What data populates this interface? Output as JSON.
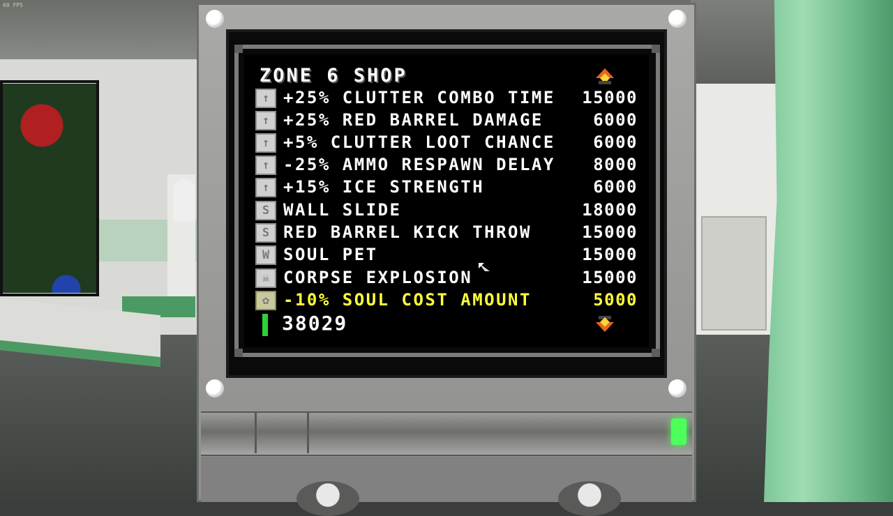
{
  "hud": {
    "fps": "60 FPS"
  },
  "shop": {
    "title": "ZONE 6 SHOP",
    "items": [
      {
        "icon": "↑",
        "label": "+25% CLUTTER COMBO TIME",
        "price": "15000"
      },
      {
        "icon": "↑",
        "label": "+25% RED BARREL DAMAGE",
        "price": "6000"
      },
      {
        "icon": "↑",
        "label": "+5% CLUTTER LOOT CHANCE",
        "price": "6000"
      },
      {
        "icon": "↑",
        "label": "-25% AMMO RESPAWN DELAY",
        "price": "8000"
      },
      {
        "icon": "↑",
        "label": "+15% ICE STRENGTH",
        "price": "6000"
      },
      {
        "icon": "S",
        "label": "WALL SLIDE",
        "price": "18000"
      },
      {
        "icon": "S",
        "label": "RED BARREL KICK THROW",
        "price": "15000"
      },
      {
        "icon": "W",
        "label": "SOUL PET",
        "price": "15000"
      },
      {
        "icon": "☠",
        "label": "CORPSE EXPLOSION",
        "price": "15000"
      },
      {
        "icon": "✿",
        "label": "-10% SOUL COST AMOUNT",
        "price": "5000",
        "selected": true
      }
    ],
    "souls": "38029",
    "selected_color": "#ffff3a",
    "soul_bar_color": "#2ed13a"
  }
}
